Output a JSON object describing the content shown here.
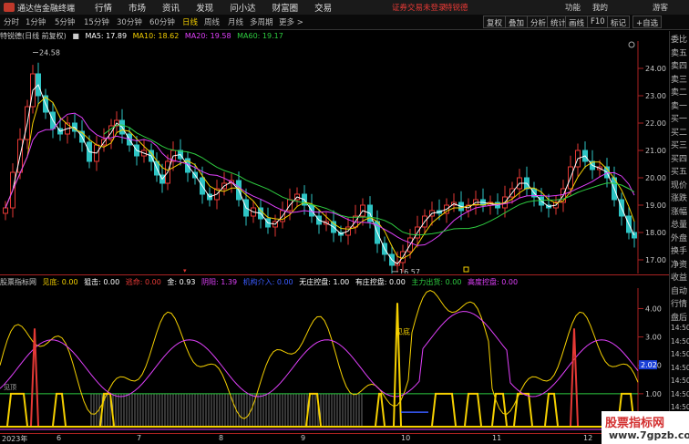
{
  "titlebar": {
    "app_title": "通达信金融终端",
    "menus": [
      "行情",
      "市场",
      "资讯",
      "发现",
      "问小达",
      "财富圈",
      "交易"
    ],
    "login_warning": "证券交易未登录",
    "stock_name": "特锐德",
    "right_buttons": [
      "功能",
      "我的",
      "游客"
    ]
  },
  "toolbar": {
    "period_tabs": [
      "分时",
      "1分钟",
      "5分钟",
      "15分钟",
      "30分钟",
      "60分钟",
      "日线",
      "周线",
      "月线",
      "多周期",
      "更多 >"
    ],
    "active_tab": "日线",
    "right_buttons": [
      "复权",
      "叠加",
      "分析",
      "统计",
      "画线",
      "F10",
      "标记",
      "+自选"
    ]
  },
  "main_chart": {
    "stock_label": "特锐德(日线 前复权)",
    "ma": [
      {
        "label": "MA5: 17.89",
        "color": "#ffffff"
      },
      {
        "label": "MA10: 18.62",
        "color": "#f5d000"
      },
      {
        "label": "MA20: 19.58",
        "color": "#e040fb"
      },
      {
        "label": "MA60: 19.17",
        "color": "#2ecc40"
      }
    ],
    "price_ticks": [
      "24.00",
      "23.00",
      "22.00",
      "21.00",
      "20.00",
      "19.00",
      "18.00",
      "17.00"
    ],
    "high_marker": "24.58",
    "low_marker": "16.57"
  },
  "sub_chart": {
    "indicator_name": "股票指标网",
    "legend": [
      {
        "label": "见底: 0.00",
        "color": "#f5d000"
      },
      {
        "label": "狙击: 0.00",
        "color": "#ffffff"
      },
      {
        "label": "逃命: 0.00",
        "color": "#e53935"
      },
      {
        "label": "金: 0.93",
        "color": "#ffffff"
      },
      {
        "label": "阴阳: 1.39",
        "color": "#e040fb"
      },
      {
        "label": "机构介入: 0.00",
        "color": "#3a5bff"
      },
      {
        "label": "无庄控盘: 1.00",
        "color": "#ffffff"
      },
      {
        "label": "有庄控盘: 0.00",
        "color": "#ffffff"
      },
      {
        "label": "主力出货: 0.00",
        "color": "#2ecc40"
      },
      {
        "label": "高度控盘: 0.00",
        "color": "#e040fb"
      }
    ],
    "ticks": [
      "4.00",
      "3.00",
      "2.00",
      "1.00"
    ],
    "current_value": "2.02",
    "label_bottom": "见底",
    "label_top": "见顶"
  },
  "right_panel": {
    "items": [
      "委比",
      "卖五",
      "卖四",
      "卖三",
      "卖二",
      "卖一",
      "买一",
      "买二",
      "买三",
      "买四",
      "买五",
      "现价",
      "涨跌",
      "涨幅",
      "总量",
      "外盘",
      "换手",
      "净资",
      "收益",
      "自动",
      "行情",
      "盘后",
      "14:50",
      "14:50",
      "14:50",
      "14:50",
      "14:50",
      "14:50",
      "14:50",
      "14:50"
    ]
  },
  "x_axis": {
    "labels": [
      "2023年",
      "6",
      "7",
      "8",
      "9",
      "10",
      "11",
      "12"
    ]
  },
  "watermark": {
    "title": "股票指标网",
    "url": "www.7gpzb.com"
  },
  "chart_data": {
    "type": "candlestick",
    "title": "特锐德(日线 前复权)",
    "ylim": [
      16.5,
      25.0
    ],
    "ma_lines": [
      "MA5",
      "MA10",
      "MA20",
      "MA60"
    ],
    "annotations": [
      {
        "label": "24.58",
        "y": 24.58
      },
      {
        "label": "16.57",
        "y": 16.57
      }
    ]
  }
}
